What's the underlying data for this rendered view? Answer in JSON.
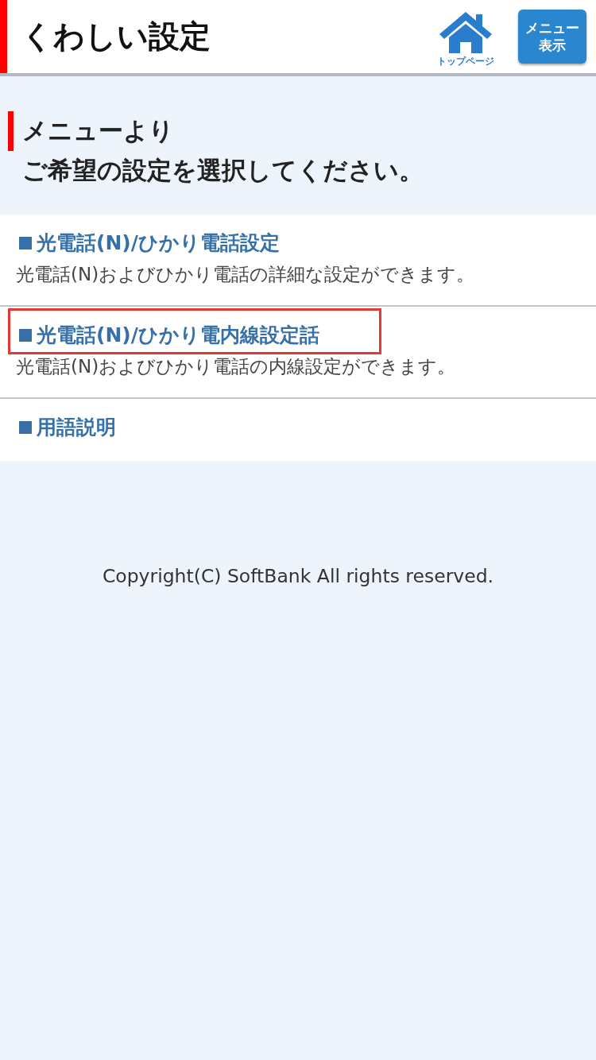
{
  "header": {
    "title": "くわしい設定",
    "home_link": {
      "label": "トップページ"
    },
    "menu_button": {
      "label": "メニュー表示"
    }
  },
  "intro": {
    "heading": "メニューより",
    "text": "ご希望の設定を選択してください。"
  },
  "items": [
    {
      "title": "光電話(N)/ひかり電話設定",
      "description": "光電話(N)およびひかり電話の詳細な設定ができます。",
      "highlighted": false
    },
    {
      "title": "光電話(N)/ひかり電内線設定話",
      "description": "光電話(N)およびひかり電話の内線設定ができます。",
      "highlighted": true
    },
    {
      "title": "用語説明",
      "highlighted": false
    }
  ],
  "footer": {
    "copyright": "Copyright(C) SoftBank All rights reserved."
  }
}
